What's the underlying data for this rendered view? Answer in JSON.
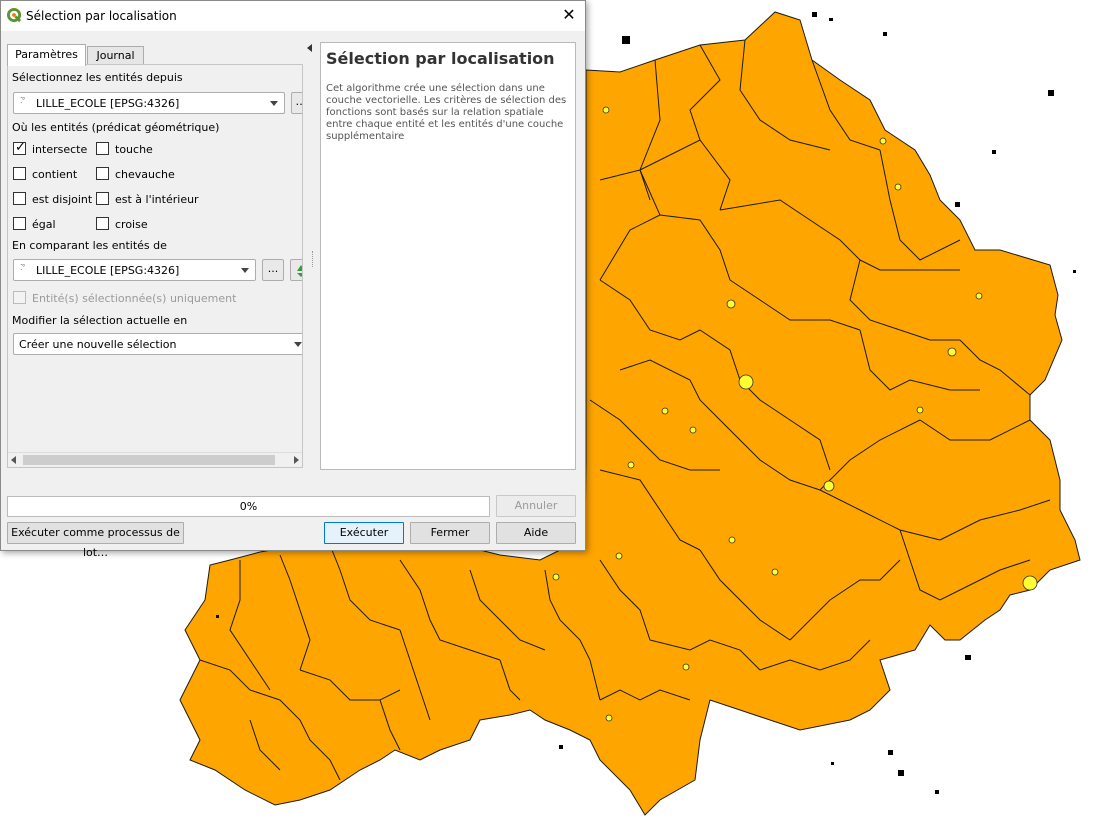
{
  "window": {
    "title": "Sélection par localisation",
    "close_symbol": "✕"
  },
  "tabs": [
    {
      "label": "Paramètres",
      "active": true
    },
    {
      "label": "Journal",
      "active": false
    }
  ],
  "params": {
    "source_label": "Sélectionnez les entités depuis",
    "source_layer": "LILLE_ECOLE [EPSG:4326]",
    "source_more": "…",
    "predicate_label": "Où les entités (prédicat géométrique)",
    "predicates": [
      {
        "label": "intersecte",
        "checked": true
      },
      {
        "label": "touche",
        "checked": false
      },
      {
        "label": "contient",
        "checked": false
      },
      {
        "label": "chevauche",
        "checked": false
      },
      {
        "label": "est disjoint",
        "checked": false
      },
      {
        "label": "est à l'intérieur",
        "checked": false
      },
      {
        "label": "égal",
        "checked": false
      },
      {
        "label": "croise",
        "checked": false
      }
    ],
    "check_mark": "✓",
    "compare_label": "En comparant les entités de",
    "compare_layer": "LILLE_ECOLE [EPSG:4326]",
    "compare_more": "...",
    "selected_only_label": "Entité(s) sélectionnée(s) uniquement",
    "modify_label": "Modifier la sélection actuelle en",
    "modify_value": "Créer une nouvelle sélection"
  },
  "help": {
    "title": "Sélection par localisation",
    "description": "Cet algorithme crée une sélection dans une couche vectorielle. Les critères de sélection des fonctions sont basés sur la relation spatiale entre chaque entité et les entités d'une couche supplémentaire"
  },
  "progress": {
    "text": "0%",
    "value": 0
  },
  "buttons": {
    "cancel": "Annuler",
    "batch": "Exécuter comme processus de lot…",
    "run": "Exécuter",
    "close": "Fermer",
    "help": "Aide"
  },
  "colors": {
    "map_fill": "#ffa500",
    "highlight": "#ffff33",
    "accent": "#0078d7",
    "qgis_green": "#589632"
  }
}
